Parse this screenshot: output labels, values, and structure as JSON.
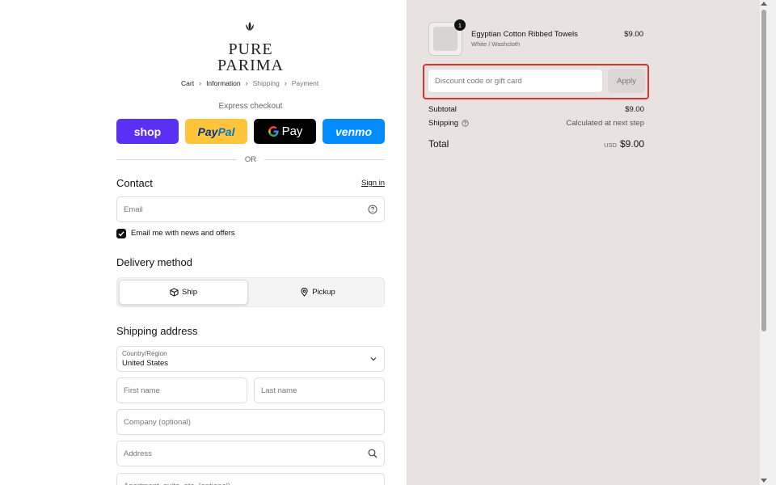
{
  "brand": {
    "line1": "PURE",
    "line2": "PARIMA"
  },
  "breadcrumb": [
    {
      "label": "Cart"
    },
    {
      "label": "Information"
    },
    {
      "label": "Shipping"
    },
    {
      "label": "Payment"
    }
  ],
  "express": {
    "title": "Express checkout",
    "shop": "shop",
    "paypal_a": "Pay",
    "paypal_b": "Pal",
    "gpay": "Pay",
    "venmo": "venmo"
  },
  "or_text": "OR",
  "contact": {
    "title": "Contact",
    "sign_in": "Sign in",
    "email_placeholder": "Email",
    "newsletter_label": "Email me with news and offers"
  },
  "delivery": {
    "title": "Delivery method",
    "ship": "Ship",
    "pickup": "Pickup"
  },
  "shipping": {
    "title": "Shipping address",
    "country_label": "Country/Region",
    "country_value": "United States",
    "first_name": "First name",
    "last_name": "Last name",
    "company": "Company (optional)",
    "address": "Address",
    "apartment": "Apartment, suite, etc. (optional)"
  },
  "cart": {
    "quantity": "1",
    "product_name": "Egyptian Cotton Ribbed Towels",
    "product_variant": "White / Washcloth",
    "product_price": "$9.00",
    "discount_placeholder": "Discount code or gift card",
    "apply": "Apply",
    "subtotal_label": "Subtotal",
    "subtotal_value": "$9.00",
    "shipping_label": "Shipping",
    "shipping_value": "Calculated at next step",
    "total_label": "Total",
    "currency": "USD",
    "total_value": "$9.00"
  },
  "colors": {
    "highlight": "#e0312e",
    "shop": "#5a31f4",
    "paypal": "#ffc439",
    "venmo": "#008cff",
    "summary_bg": "#e8e3e1"
  }
}
